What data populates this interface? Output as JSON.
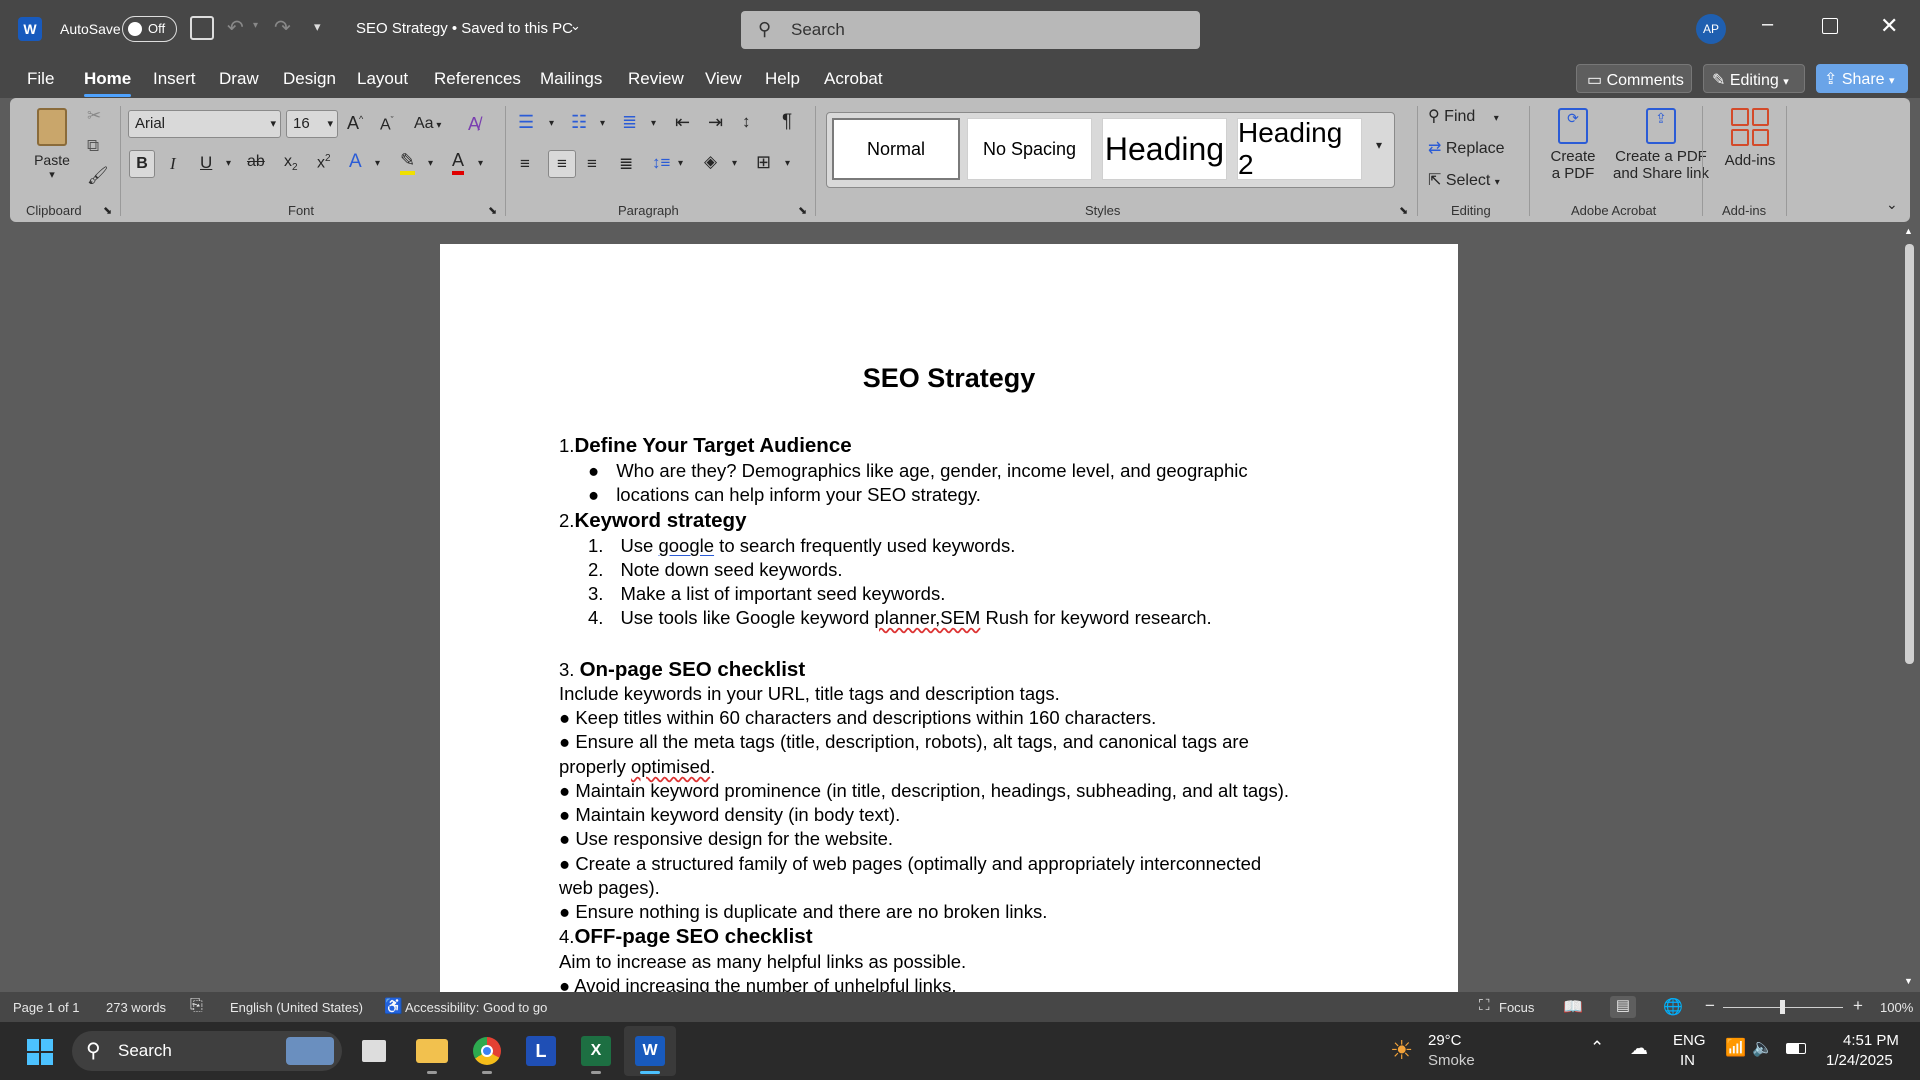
{
  "titlebar": {
    "autosave_label": "AutoSave",
    "autosave_state": "Off",
    "doc_title": "SEO Strategy • Saved to this PC",
    "search_placeholder": "Search",
    "avatar_initials": "AP"
  },
  "menu": {
    "tabs": [
      "File",
      "Home",
      "Insert",
      "Draw",
      "Design",
      "Layout",
      "References",
      "Mailings",
      "Review",
      "View",
      "Help",
      "Acrobat"
    ],
    "active_tab": "Home",
    "comments_label": "Comments",
    "editing_label": "Editing",
    "share_label": "Share"
  },
  "ribbon": {
    "clipboard": {
      "paste_label": "Paste",
      "group_label": "Clipboard"
    },
    "font": {
      "name": "Arial",
      "size": "16",
      "group_label": "Font",
      "case_label": "Aa"
    },
    "paragraph": {
      "group_label": "Paragraph"
    },
    "styles": {
      "items": [
        "Normal",
        "No Spacing",
        "Heading",
        "Heading 2"
      ],
      "group_label": "Styles"
    },
    "editing": {
      "find": "Find",
      "replace": "Replace",
      "select": "Select",
      "group_label": "Editing"
    },
    "acrobat": {
      "create_pdf_1": "Create",
      "create_pdf_2": "a PDF",
      "share_1": "Create a PDF",
      "share_2": "and Share link",
      "group_label": "Adobe Acrobat"
    },
    "addins": {
      "label": "Add-ins",
      "group_label": "Add-ins"
    }
  },
  "document": {
    "title": "SEO Strategy",
    "s1_num": "1.",
    "s1_heading": "Define Your Target Audience",
    "s1_bullets": [
      "Who are they? Demographics like age, gender, income level, and geographic",
      "locations can help inform your SEO strategy."
    ],
    "s2_num": "2.",
    "s2_heading": "Keyword strategy",
    "s2_item1_a": "Use ",
    "s2_item1_b": "google",
    "s2_item1_c": " to search frequently used keywords.",
    "s2_item2": "Note down seed keywords.",
    "s2_item3": "Make a list of important seed keywords.",
    "s2_item4_a": "Use tools like Google keyword ",
    "s2_item4_b": "planner,SEM",
    "s2_item4_c": " Rush for keyword research.",
    "s2_nums": [
      "1.",
      "2.",
      "3.",
      "4."
    ],
    "s3_num": "3. ",
    "s3_heading": "On-page SEO checklist",
    "s3_lines": [
      "Include keywords in your URL, title tags and description tags.",
      "● Keep titles within 60 characters and descriptions within 160 characters.",
      "● Ensure all the meta tags (title, description, robots), alt tags, and canonical tags are",
      "properly ",
      "optimised",
      ".",
      "● Maintain keyword prominence (in title, description, headings, subheading, and alt tags).",
      "● Maintain keyword density (in body text).",
      "● Use responsive design for the website.",
      "● Create a structured family of web pages (optimally and appropriately interconnected",
      "web pages).",
      "● Ensure nothing is duplicate and there are no broken links."
    ],
    "s4_num": "4.",
    "s4_heading": "OFF-page SEO checklist",
    "s4_lines": [
      "Aim to increase as many helpful links as possible.",
      "● Avoid increasing the number of unhelpful links."
    ]
  },
  "status": {
    "page": "Page 1 of 1",
    "words": "273 words",
    "language": "English (United States)",
    "accessibility": "Accessibility: Good to go",
    "focus": "Focus",
    "zoom": "100%"
  },
  "taskbar": {
    "search": "Search",
    "weather_temp": "29°C",
    "weather_desc": "Smoke",
    "lang1": "ENG",
    "lang2": "IN",
    "time": "4:51 PM",
    "date": "1/24/2025"
  },
  "colors": {
    "accent": "#4fa3ff",
    "word_blue": "#185abd",
    "excel_green": "#1d6f42"
  }
}
